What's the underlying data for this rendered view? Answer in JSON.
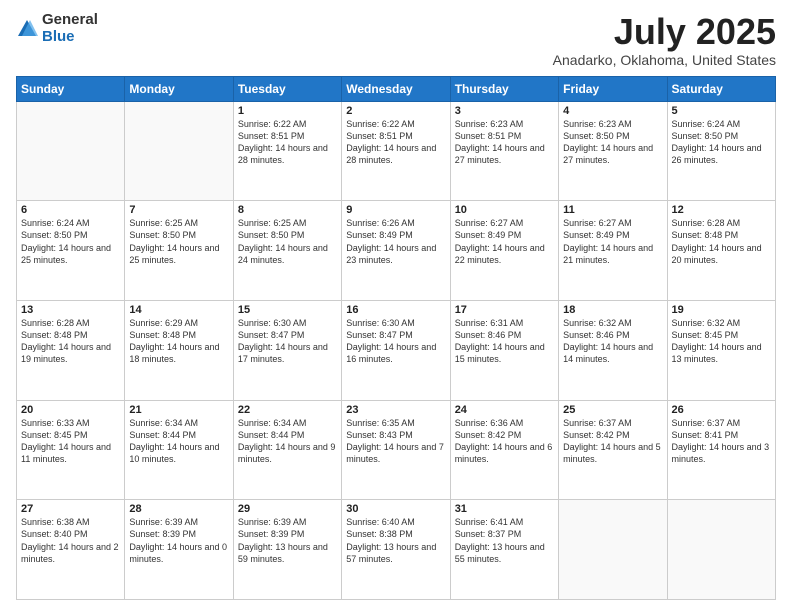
{
  "logo": {
    "general": "General",
    "blue": "Blue"
  },
  "title": "July 2025",
  "subtitle": "Anadarko, Oklahoma, United States",
  "days_of_week": [
    "Sunday",
    "Monday",
    "Tuesday",
    "Wednesday",
    "Thursday",
    "Friday",
    "Saturday"
  ],
  "weeks": [
    [
      {
        "day": "",
        "sunrise": "",
        "sunset": "",
        "daylight": ""
      },
      {
        "day": "",
        "sunrise": "",
        "sunset": "",
        "daylight": ""
      },
      {
        "day": "1",
        "sunrise": "Sunrise: 6:22 AM",
        "sunset": "Sunset: 8:51 PM",
        "daylight": "Daylight: 14 hours and 28 minutes."
      },
      {
        "day": "2",
        "sunrise": "Sunrise: 6:22 AM",
        "sunset": "Sunset: 8:51 PM",
        "daylight": "Daylight: 14 hours and 28 minutes."
      },
      {
        "day": "3",
        "sunrise": "Sunrise: 6:23 AM",
        "sunset": "Sunset: 8:51 PM",
        "daylight": "Daylight: 14 hours and 27 minutes."
      },
      {
        "day": "4",
        "sunrise": "Sunrise: 6:23 AM",
        "sunset": "Sunset: 8:50 PM",
        "daylight": "Daylight: 14 hours and 27 minutes."
      },
      {
        "day": "5",
        "sunrise": "Sunrise: 6:24 AM",
        "sunset": "Sunset: 8:50 PM",
        "daylight": "Daylight: 14 hours and 26 minutes."
      }
    ],
    [
      {
        "day": "6",
        "sunrise": "Sunrise: 6:24 AM",
        "sunset": "Sunset: 8:50 PM",
        "daylight": "Daylight: 14 hours and 25 minutes."
      },
      {
        "day": "7",
        "sunrise": "Sunrise: 6:25 AM",
        "sunset": "Sunset: 8:50 PM",
        "daylight": "Daylight: 14 hours and 25 minutes."
      },
      {
        "day": "8",
        "sunrise": "Sunrise: 6:25 AM",
        "sunset": "Sunset: 8:50 PM",
        "daylight": "Daylight: 14 hours and 24 minutes."
      },
      {
        "day": "9",
        "sunrise": "Sunrise: 6:26 AM",
        "sunset": "Sunset: 8:49 PM",
        "daylight": "Daylight: 14 hours and 23 minutes."
      },
      {
        "day": "10",
        "sunrise": "Sunrise: 6:27 AM",
        "sunset": "Sunset: 8:49 PM",
        "daylight": "Daylight: 14 hours and 22 minutes."
      },
      {
        "day": "11",
        "sunrise": "Sunrise: 6:27 AM",
        "sunset": "Sunset: 8:49 PM",
        "daylight": "Daylight: 14 hours and 21 minutes."
      },
      {
        "day": "12",
        "sunrise": "Sunrise: 6:28 AM",
        "sunset": "Sunset: 8:48 PM",
        "daylight": "Daylight: 14 hours and 20 minutes."
      }
    ],
    [
      {
        "day": "13",
        "sunrise": "Sunrise: 6:28 AM",
        "sunset": "Sunset: 8:48 PM",
        "daylight": "Daylight: 14 hours and 19 minutes."
      },
      {
        "day": "14",
        "sunrise": "Sunrise: 6:29 AM",
        "sunset": "Sunset: 8:48 PM",
        "daylight": "Daylight: 14 hours and 18 minutes."
      },
      {
        "day": "15",
        "sunrise": "Sunrise: 6:30 AM",
        "sunset": "Sunset: 8:47 PM",
        "daylight": "Daylight: 14 hours and 17 minutes."
      },
      {
        "day": "16",
        "sunrise": "Sunrise: 6:30 AM",
        "sunset": "Sunset: 8:47 PM",
        "daylight": "Daylight: 14 hours and 16 minutes."
      },
      {
        "day": "17",
        "sunrise": "Sunrise: 6:31 AM",
        "sunset": "Sunset: 8:46 PM",
        "daylight": "Daylight: 14 hours and 15 minutes."
      },
      {
        "day": "18",
        "sunrise": "Sunrise: 6:32 AM",
        "sunset": "Sunset: 8:46 PM",
        "daylight": "Daylight: 14 hours and 14 minutes."
      },
      {
        "day": "19",
        "sunrise": "Sunrise: 6:32 AM",
        "sunset": "Sunset: 8:45 PM",
        "daylight": "Daylight: 14 hours and 13 minutes."
      }
    ],
    [
      {
        "day": "20",
        "sunrise": "Sunrise: 6:33 AM",
        "sunset": "Sunset: 8:45 PM",
        "daylight": "Daylight: 14 hours and 11 minutes."
      },
      {
        "day": "21",
        "sunrise": "Sunrise: 6:34 AM",
        "sunset": "Sunset: 8:44 PM",
        "daylight": "Daylight: 14 hours and 10 minutes."
      },
      {
        "day": "22",
        "sunrise": "Sunrise: 6:34 AM",
        "sunset": "Sunset: 8:44 PM",
        "daylight": "Daylight: 14 hours and 9 minutes."
      },
      {
        "day": "23",
        "sunrise": "Sunrise: 6:35 AM",
        "sunset": "Sunset: 8:43 PM",
        "daylight": "Daylight: 14 hours and 7 minutes."
      },
      {
        "day": "24",
        "sunrise": "Sunrise: 6:36 AM",
        "sunset": "Sunset: 8:42 PM",
        "daylight": "Daylight: 14 hours and 6 minutes."
      },
      {
        "day": "25",
        "sunrise": "Sunrise: 6:37 AM",
        "sunset": "Sunset: 8:42 PM",
        "daylight": "Daylight: 14 hours and 5 minutes."
      },
      {
        "day": "26",
        "sunrise": "Sunrise: 6:37 AM",
        "sunset": "Sunset: 8:41 PM",
        "daylight": "Daylight: 14 hours and 3 minutes."
      }
    ],
    [
      {
        "day": "27",
        "sunrise": "Sunrise: 6:38 AM",
        "sunset": "Sunset: 8:40 PM",
        "daylight": "Daylight: 14 hours and 2 minutes."
      },
      {
        "day": "28",
        "sunrise": "Sunrise: 6:39 AM",
        "sunset": "Sunset: 8:39 PM",
        "daylight": "Daylight: 14 hours and 0 minutes."
      },
      {
        "day": "29",
        "sunrise": "Sunrise: 6:39 AM",
        "sunset": "Sunset: 8:39 PM",
        "daylight": "Daylight: 13 hours and 59 minutes."
      },
      {
        "day": "30",
        "sunrise": "Sunrise: 6:40 AM",
        "sunset": "Sunset: 8:38 PM",
        "daylight": "Daylight: 13 hours and 57 minutes."
      },
      {
        "day": "31",
        "sunrise": "Sunrise: 6:41 AM",
        "sunset": "Sunset: 8:37 PM",
        "daylight": "Daylight: 13 hours and 55 minutes."
      },
      {
        "day": "",
        "sunrise": "",
        "sunset": "",
        "daylight": ""
      },
      {
        "day": "",
        "sunrise": "",
        "sunset": "",
        "daylight": ""
      }
    ]
  ]
}
